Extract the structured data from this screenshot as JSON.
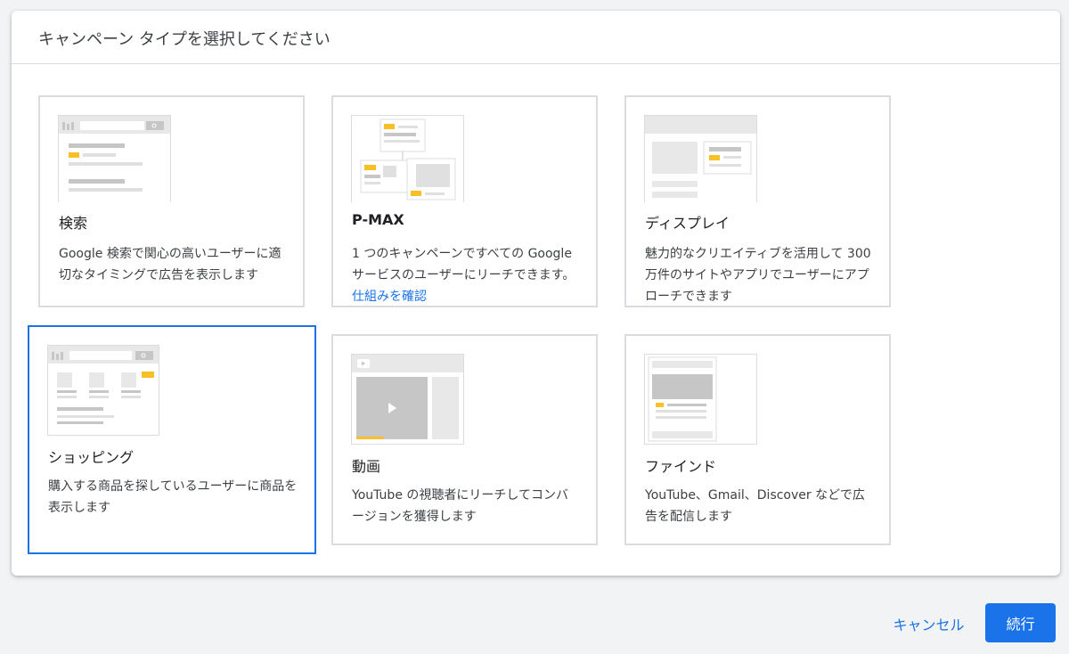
{
  "dialog": {
    "title": "キャンペーン タイプを選択してください"
  },
  "cards": [
    {
      "id": "search",
      "title": "検索",
      "description": "Google 検索で関心の高いユーザーに適切なタイミングで広告を表示します",
      "selected": false
    },
    {
      "id": "pmax",
      "title": "P-MAX",
      "description": "1 つのキャンペーンですべての Google サービスのユーザーにリーチできます。",
      "link": "仕組みを確認",
      "selected": false
    },
    {
      "id": "display",
      "title": "ディスプレイ",
      "description": "魅力的なクリエイティブを活用して 300 万件のサイトやアプリでユーザーにアプローチできます",
      "selected": false
    },
    {
      "id": "shopping",
      "title": "ショッピング",
      "description": "購入する商品を探しているユーザーに商品を表示します",
      "selected": true
    },
    {
      "id": "video",
      "title": "動画",
      "description": "YouTube の視聴者にリーチしてコンバージョンを獲得します",
      "selected": false
    },
    {
      "id": "discovery",
      "title": "ファインド",
      "description": "YouTube、Gmail、Discover などで広告を配信します",
      "selected": false
    }
  ],
  "footer": {
    "cancel_label": "キャンセル",
    "continue_label": "続行"
  },
  "colors": {
    "accent": "#1a73e8",
    "highlight": "#f6c026",
    "placeholder": "#c6c6c6",
    "placeholder_light": "#e8e8e8"
  }
}
